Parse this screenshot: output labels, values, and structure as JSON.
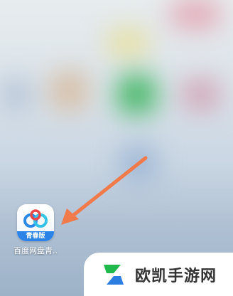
{
  "home_screen": {
    "app": {
      "icon": "baidu-netdisk-icon",
      "badge_label": "青春版",
      "label": "百度网盘青.."
    },
    "annotation_arrow": {
      "icon": "arrow-icon",
      "color": "#f07a4a"
    }
  },
  "watermark": {
    "logo_icon": "site-logo-icon",
    "text": "欧凯手游网",
    "logo_colors": [
      "#1fb84a",
      "#2b7de0"
    ]
  }
}
